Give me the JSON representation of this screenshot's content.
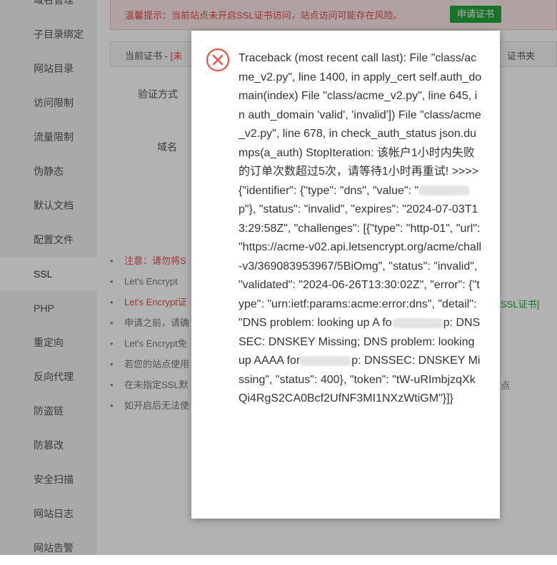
{
  "sidebar": {
    "items": [
      {
        "label": "域名管理"
      },
      {
        "label": "子目录绑定"
      },
      {
        "label": "网站目录"
      },
      {
        "label": "访问限制"
      },
      {
        "label": "流量限制"
      },
      {
        "label": "伪静态"
      },
      {
        "label": "默认文档"
      },
      {
        "label": "配置文件"
      },
      {
        "label": "SSL",
        "active": true
      },
      {
        "label": "PHP"
      },
      {
        "label": "重定向"
      },
      {
        "label": "反向代理"
      },
      {
        "label": "防盗链"
      },
      {
        "label": "防篡改"
      },
      {
        "label": "安全扫描"
      },
      {
        "label": "网站日志"
      },
      {
        "label": "网站告警"
      }
    ]
  },
  "warning": {
    "text": "温馨提示：当前站点未开启SSL证书访问，站点访问可能存在风险。",
    "button": "申请证书"
  },
  "tabs": {
    "current_prefix": "当前证书 - ",
    "current_status": "[未",
    "folder": "证书夹"
  },
  "form": {
    "verify_label": "验证方式",
    "domain_label": "域名"
  },
  "notes": [
    {
      "text": "注意：请勿将S",
      "red": true
    },
    {
      "text": "Let's Encrypt",
      "red": false
    },
    {
      "text": "Let's Encrypt证",
      "red": true
    },
    {
      "text": "申请之前，请确",
      "red": false
    },
    {
      "text": "Let's Encrypt免",
      "red": false
    },
    {
      "text": "若您的站点使用",
      "red": false
    },
    {
      "text": "在未指定SSL默",
      "red": false
    },
    {
      "text": "如开启后无法使",
      "red": false
    }
  ],
  "right_fragments": {
    "ssl_link": "SSL证书]",
    "dot_text": "点"
  },
  "dialog": {
    "icon": "error-x-icon",
    "message_parts": {
      "p1": "Traceback (most recent call last): File \"class/acme_v2.py\", line 1400, in apply_cert self.auth_domain(index) File \"class/acme_v2.py\", line 645, in auth_domain 'valid', 'invalid']) File \"class/acme_v2.py\", line 678, in check_auth_status json.dumps(a_auth) StopIteration: 该帐户1小时内失败的订单次数超过5次，请等待1小时再重试! >>>> {\"identifier\": {\"type\": \"dns\", \"value\": \"",
      "p2": "p\"}, \"status\": \"invalid\", \"expires\": \"2024-07-03T13:29:58Z\", \"challenges\": [{\"type\": \"http-01\", \"url\": \"https://acme-v02.api.letsencrypt.org/acme/chall-v3/369083953967/5BiOmg\", \"status\": \"invalid\", \"validated\": \"2024-06-26T13:30:02Z\", \"error\": {\"type\": \"urn:ietf:params:acme:error:dns\", \"detail\": \"DNS problem: looking up A fo",
      "p3": "p: DNSSEC: DNSKEY Missing; DNS problem: looking up AAAA for",
      "p4": "p: DNSSEC: DNSKEY Missing\", \"status\": 400}, \"token\": \"tW-uRImbjzqXkQi4RgS2CA0Bcf2UfNF3MI1NXzWtiGM\"}]}"
    }
  }
}
